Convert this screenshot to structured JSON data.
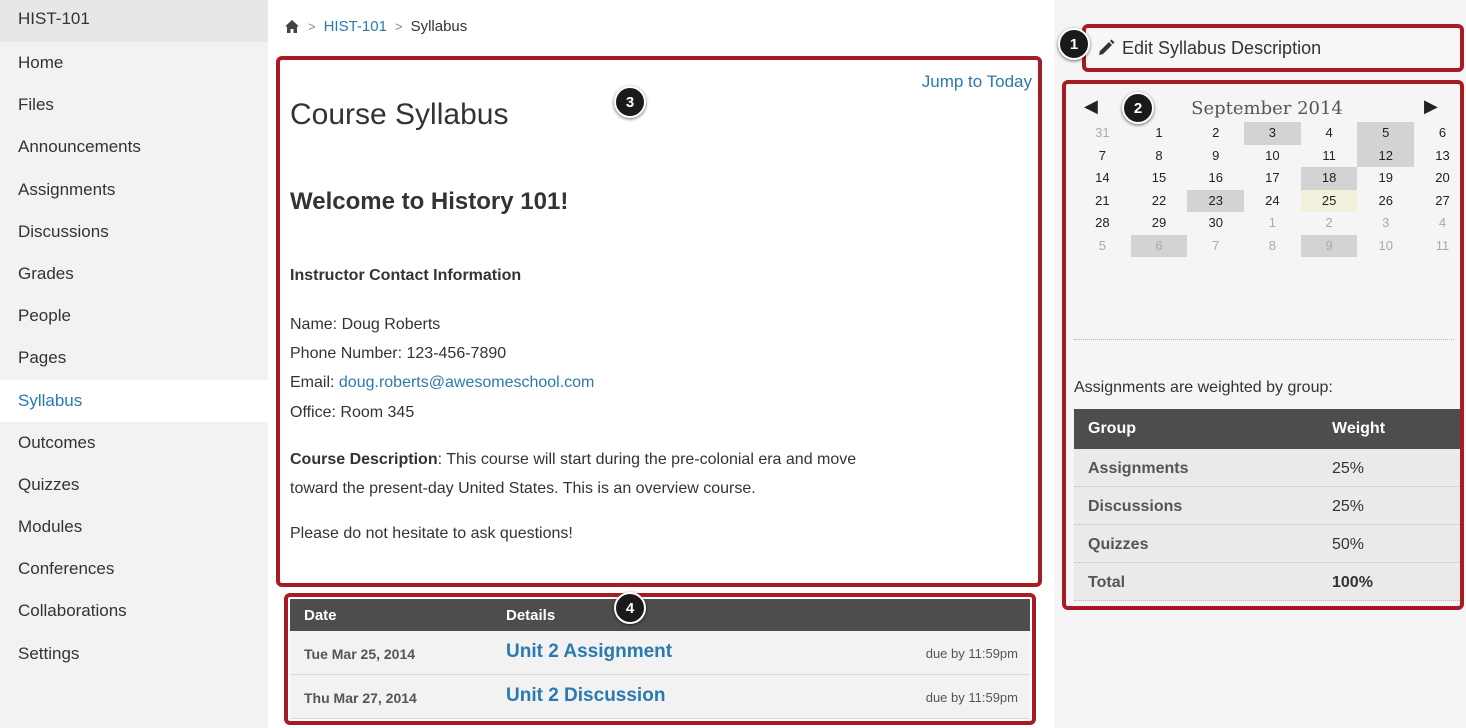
{
  "sidebar": {
    "course": "HIST-101",
    "items": [
      "Home",
      "Files",
      "Announcements",
      "Assignments",
      "Discussions",
      "Grades",
      "People",
      "Pages",
      "Syllabus",
      "Outcomes",
      "Quizzes",
      "Modules",
      "Conferences",
      "Collaborations",
      "Settings"
    ],
    "active": "Syllabus"
  },
  "breadcrumb": {
    "icon": "home-icon",
    "course": "HIST-101",
    "current": "Syllabus"
  },
  "edit_button": {
    "label": "Edit Syllabus Description",
    "icon": "pencil-icon"
  },
  "badges": [
    "1",
    "2",
    "3",
    "4"
  ],
  "syllabus": {
    "jump_today": "Jump to Today",
    "title": "Course Syllabus",
    "welcome": "Welcome to History 101!",
    "contact_heading": "Instructor Contact Information",
    "name": "Name: Doug Roberts",
    "phone": "Phone Number: 123-456-7890",
    "email_label": "Email: ",
    "email": "doug.roberts@awesomeschool.com",
    "office": "Office: Room 345",
    "desc_label": "Course Description",
    "desc_line1": ": This course will start during the pre-colonial era and move",
    "desc_line2": "toward the present-day United States. This is an overview course.",
    "closing": "Please do not hesitate to ask questions!"
  },
  "assignments": {
    "headers": {
      "date": "Date",
      "details": "Details"
    },
    "rows": [
      {
        "date": "Tue Mar 25, 2014",
        "title": "Unit 2 Assignment",
        "due": "due by 11:59pm"
      },
      {
        "date": "Thu Mar 27, 2014",
        "title": "Unit 2 Discussion",
        "due": "due by 11:59pm"
      }
    ]
  },
  "calendar": {
    "month": "September 2014",
    "prev": "◀",
    "next": "▶",
    "weeks": [
      [
        [
          "31",
          "other"
        ],
        [
          "1",
          ""
        ],
        [
          "2",
          ""
        ],
        [
          "3",
          "event"
        ],
        [
          "4",
          ""
        ],
        [
          "5",
          "event"
        ],
        [
          "6",
          ""
        ]
      ],
      [
        [
          "7",
          ""
        ],
        [
          "8",
          ""
        ],
        [
          "9",
          ""
        ],
        [
          "10",
          ""
        ],
        [
          "11",
          ""
        ],
        [
          "12",
          "event"
        ],
        [
          "13",
          ""
        ]
      ],
      [
        [
          "14",
          ""
        ],
        [
          "15",
          ""
        ],
        [
          "16",
          ""
        ],
        [
          "17",
          ""
        ],
        [
          "18",
          "event"
        ],
        [
          "19",
          ""
        ],
        [
          "20",
          ""
        ]
      ],
      [
        [
          "21",
          ""
        ],
        [
          "22",
          ""
        ],
        [
          "23",
          "event"
        ],
        [
          "24",
          ""
        ],
        [
          "25",
          "today"
        ],
        [
          "26",
          ""
        ],
        [
          "27",
          ""
        ]
      ],
      [
        [
          "28",
          ""
        ],
        [
          "29",
          ""
        ],
        [
          "30",
          ""
        ],
        [
          "1",
          "other"
        ],
        [
          "2",
          "other"
        ],
        [
          "3",
          "other"
        ],
        [
          "4",
          "other"
        ]
      ],
      [
        [
          "5",
          "other"
        ],
        [
          "6",
          "other event"
        ],
        [
          "7",
          "other"
        ],
        [
          "8",
          "other"
        ],
        [
          "9",
          "other event"
        ],
        [
          "10",
          "other"
        ],
        [
          "11",
          "other"
        ]
      ]
    ]
  },
  "weights": {
    "label": "Assignments are weighted by group:",
    "headers": {
      "group": "Group",
      "weight": "Weight"
    },
    "rows": [
      {
        "group": "Assignments",
        "weight": "25%"
      },
      {
        "group": "Discussions",
        "weight": "25%"
      },
      {
        "group": "Quizzes",
        "weight": "50%"
      },
      {
        "group": "Total",
        "weight": "100%"
      }
    ]
  },
  "colors": {
    "accent": "#2a7ab0",
    "outline": "#a51c24",
    "header_bg": "#4d4d4d"
  }
}
